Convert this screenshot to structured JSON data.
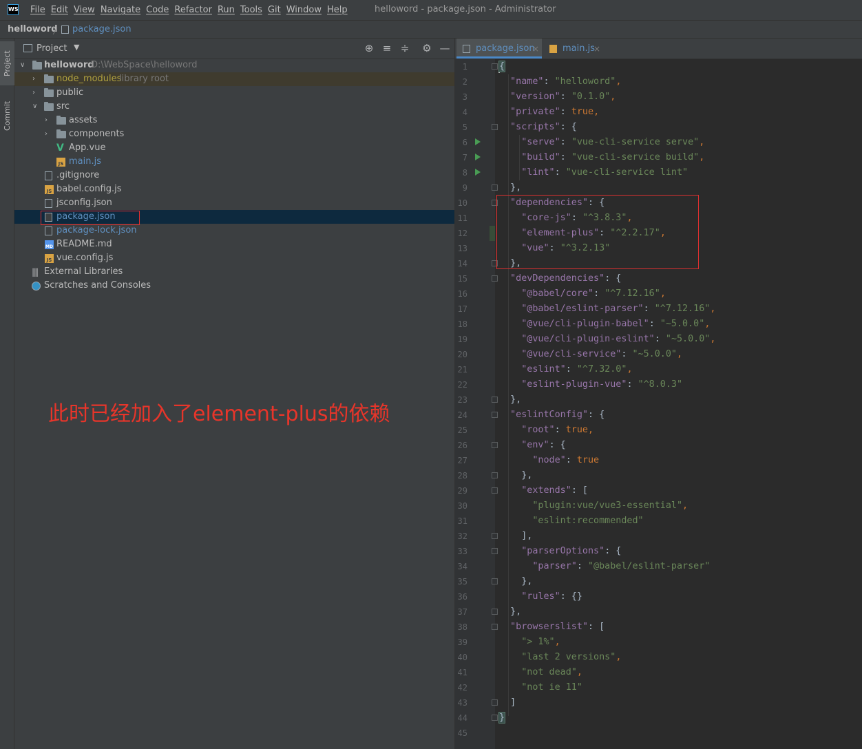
{
  "app": {
    "logo_text": "WS",
    "menu": [
      "File",
      "Edit",
      "View",
      "Navigate",
      "Code",
      "Refactor",
      "Run",
      "Tools",
      "Git",
      "Window",
      "Help"
    ],
    "window_title": "helloword - package.json - Administrator"
  },
  "navbar": {
    "root": "helloword",
    "separator": "〉",
    "file": "package.json"
  },
  "toolstrip": {
    "project": "Project",
    "commit": "Commit"
  },
  "project_panel": {
    "title": "Project",
    "chevron": "▼",
    "tools": [
      "locate-icon",
      "expand-all-icon",
      "collapse-all-icon",
      "gear-icon",
      "minimize-icon"
    ],
    "tree": {
      "root_name": "helloword",
      "root_path": "D:\\WebSpace\\helloword",
      "node_modules": "node_modules",
      "library_root": "library root",
      "public": "public",
      "src": "src",
      "assets": "assets",
      "components": "components",
      "app_vue": "App.vue",
      "main_js": "main.js",
      "gitignore": ".gitignore",
      "babel_config": "babel.config.js",
      "jsconfig": "jsconfig.json",
      "package_json": "package.json",
      "package_lock": "package-lock.json",
      "readme": "README.md",
      "vue_config": "vue.config.js",
      "external_libraries": "External Libraries",
      "scratches": "Scratches and Consoles"
    }
  },
  "annotation_text": "此时已经加入了element-plus的依赖",
  "editor": {
    "tabs": [
      {
        "label": "package.json",
        "close": "×"
      },
      {
        "label": "main.js",
        "close": "×"
      }
    ],
    "line_numbers": [
      "1",
      "2",
      "3",
      "4",
      "5",
      "6",
      "7",
      "8",
      "9",
      "10",
      "11",
      "12",
      "13",
      "14",
      "15",
      "16",
      "17",
      "18",
      "19",
      "20",
      "21",
      "22",
      "23",
      "24",
      "25",
      "26",
      "27",
      "28",
      "29",
      "30",
      "31",
      "32",
      "33",
      "34",
      "35",
      "36",
      "37",
      "38",
      "39",
      "40",
      "41",
      "42",
      "43",
      "44",
      "45"
    ],
    "code": {
      "l1": "{",
      "name_key": "\"name\"",
      "name_val": "\"helloword\"",
      "version_key": "\"version\"",
      "version_val": "\"0.1.0\"",
      "private_key": "\"private\"",
      "private_val": "true",
      "scripts_key": "\"scripts\"",
      "serve_key": "\"serve\"",
      "serve_val": "\"vue-cli-service serve\"",
      "build_key": "\"build\"",
      "build_val": "\"vue-cli-service build\"",
      "lint_key": "\"lint\"",
      "lint_val": "\"vue-cli-service lint\"",
      "dependencies_key": "\"dependencies\"",
      "corejs_key": "\"core-js\"",
      "corejs_val": "\"^3.8.3\"",
      "elementplus_key": "\"element-plus\"",
      "elementplus_val": "\"^2.2.17\"",
      "vue_key": "\"vue\"",
      "vue_val": "\"^3.2.13\"",
      "devdeps_key": "\"devDependencies\"",
      "babelcore_key": "\"@babel/core\"",
      "babelcore_val": "\"^7.12.16\"",
      "babelparser_key": "\"@babel/eslint-parser\"",
      "babelparser_val": "\"^7.12.16\"",
      "clibabel_key": "\"@vue/cli-plugin-babel\"",
      "clibabel_val": "\"~5.0.0\"",
      "clieslint_key": "\"@vue/cli-plugin-eslint\"",
      "clieslint_val": "\"~5.0.0\"",
      "cliservice_key": "\"@vue/cli-service\"",
      "cliservice_val": "\"~5.0.0\"",
      "eslint_key": "\"eslint\"",
      "eslint_val": "\"^7.32.0\"",
      "eslintvue_key": "\"eslint-plugin-vue\"",
      "eslintvue_val": "\"^8.0.3\"",
      "eslintconfig_key": "\"eslintConfig\"",
      "root_key": "\"root\"",
      "root_val": "true",
      "env_key": "\"env\"",
      "node_key": "\"node\"",
      "node_val": "true",
      "extends_key": "\"extends\"",
      "ext1": "\"plugin:vue/vue3-essential\"",
      "ext2": "\"eslint:recommended\"",
      "parseroptions_key": "\"parserOptions\"",
      "parser_key": "\"parser\"",
      "parser_val": "\"@babel/eslint-parser\"",
      "rules_key": "\"rules\"",
      "rules_val": "{}",
      "browserslist_key": "\"browserslist\"",
      "bl1": "\"> 1%\"",
      "bl2": "\"last 2 versions\"",
      "bl3": "\"not dead\"",
      "bl4": "\"not ie 11\"",
      "close_bracket": "]",
      "close_brace": "}"
    }
  },
  "colors": {
    "background": "#2b2b2b",
    "panel": "#3c3f41",
    "key": "#9876aa",
    "string": "#6a8759",
    "keyword": "#cc7832",
    "annotation_red": "#e8352a",
    "selection": "#0d293e"
  }
}
